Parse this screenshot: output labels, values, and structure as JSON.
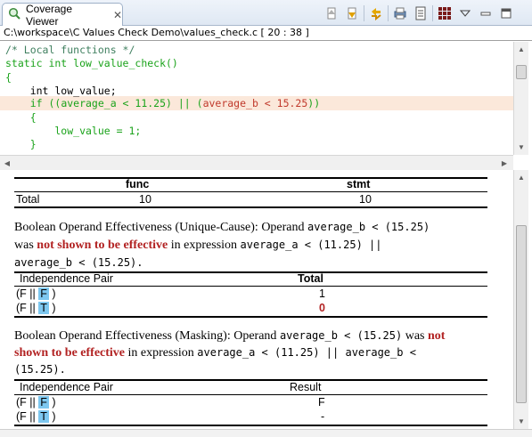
{
  "tab": {
    "title": "Coverage Viewer",
    "close_glyph": "✕"
  },
  "toolbar": {
    "icons": [
      "scroll-up-icon",
      "scroll-down-icon",
      "sync-icon",
      "print-icon",
      "report-icon",
      "grid-icon",
      "view-menu-icon",
      "minimize-icon",
      "maximize-icon"
    ]
  },
  "path": "C:\\workspace\\C Values Check Demo\\values_check.c  [ 20 : 38 ]",
  "code": {
    "line1": "/* Local functions */",
    "line2": "static int low_value_check()",
    "line3": "{",
    "line4": "    int low_value;",
    "line5_kw": "    if ((",
    "line5_a": "average_a < 11.25",
    "line5_mid": ") || (",
    "line5_b": "average_b < 15.25",
    "line5_end": "))",
    "line6": "    {",
    "line7": "        low_value = 1;",
    "line8": "    }"
  },
  "summary": {
    "col_func": "func",
    "col_stmt": "stmt",
    "row_label": "Total",
    "func_value": "10",
    "stmt_value": "10"
  },
  "unique_cause": {
    "p1": "Boolean Operand Effectiveness (Unique-Cause): Operand ",
    "operand": "average_b < (15.25)",
    "p2": "was ",
    "not_effective": "not shown to be effective",
    "p3": " in expression ",
    "expr1": "average_a < (11.25) ||",
    "expr2": "average_b < (15.25).",
    "col1": "Independence Pair",
    "col2": "Total",
    "rows": [
      {
        "pre": "(F || ",
        "hl": "F",
        "post": " )",
        "value": "1"
      },
      {
        "pre": "(F || ",
        "hl": "T",
        "post": " )",
        "value": "0"
      }
    ]
  },
  "masking": {
    "p1": "Boolean Operand Effectiveness (Masking): Operand ",
    "operand": "average_b < (15.25)",
    "p2": " was ",
    "not_effective_1": "not",
    "not_effective_2": "shown to be effective",
    "p3": " in expression ",
    "expr1": "average_a < (11.25) || average_b <",
    "expr2": "(15.25).",
    "col1": "Independence Pair",
    "col2": "Result",
    "rows": [
      {
        "pre": "(F || ",
        "hl": "F",
        "post": " )",
        "value": "F"
      },
      {
        "pre": "(F || ",
        "hl": "T",
        "post": " )",
        "value": "-"
      }
    ]
  },
  "colors": {
    "highlight_line": "#fbe8da",
    "cell_highlight": "#7ec8f0",
    "alert_red": "#b22222"
  }
}
